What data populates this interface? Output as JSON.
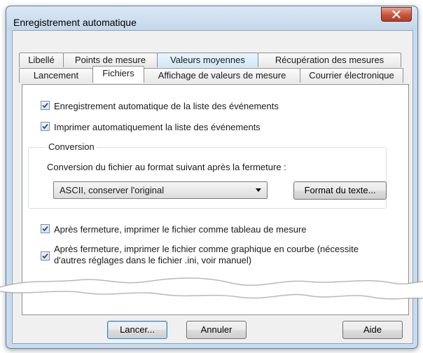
{
  "window": {
    "title": "Enregistrement automatique"
  },
  "tabs": {
    "row1": [
      "Libellé",
      "Points de mesure",
      "Valeurs moyennes",
      "Récupération des mesures"
    ],
    "row2": [
      "Lancement",
      "Fichiers",
      "Affichage de valeurs de mesure",
      "Courrier électronique"
    ],
    "active": "Fichiers",
    "highlighted": "Valeurs moyennes"
  },
  "panel": {
    "checkboxes": [
      {
        "label": "Enregistrement automatique de la liste des événements",
        "checked": true
      },
      {
        "label": "Imprimer automatiquement la liste des événements",
        "checked": true
      }
    ],
    "conversion": {
      "group_label": "Conversion",
      "description": "Conversion du fichier au format suivant après la fermeture :",
      "format_selected": "ASCII, conserver l'original",
      "format_button": "Format du texte..."
    },
    "after_close": [
      {
        "label": "Après fermeture, imprimer le fichier comme tableau de mesure",
        "checked": true
      },
      {
        "label_line1": "Après fermeture, imprimer le fichier comme graphique en courbe (nécessite",
        "label_line2": "d'autres réglages dans le fichier .ini, voir manuel)",
        "checked": true
      }
    ]
  },
  "footer": {
    "start_label": "Lancer...",
    "cancel_label": "Annuler",
    "help_label": "Aide"
  },
  "colors": {
    "frame": "#c9dcee",
    "panel": "#ffffff",
    "close_button": "#c8523a"
  }
}
